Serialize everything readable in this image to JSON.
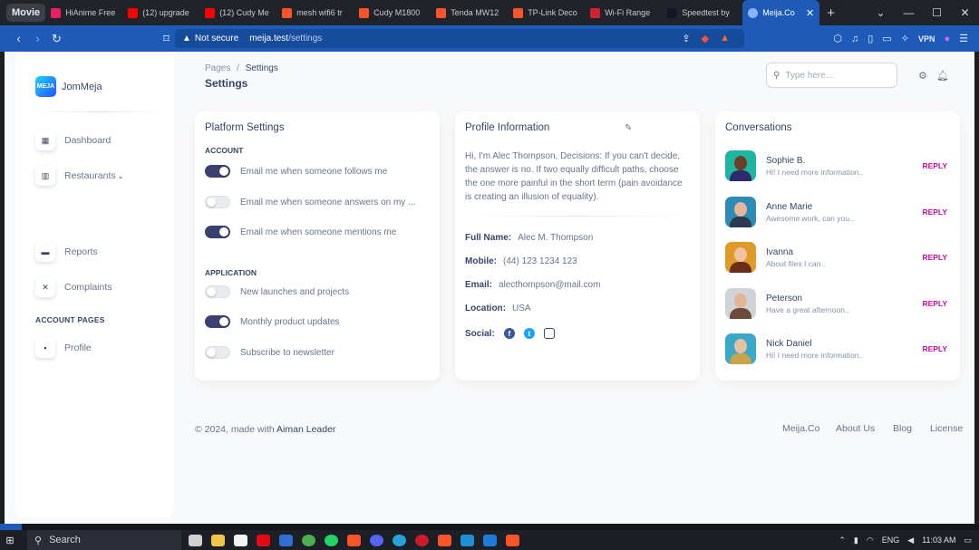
{
  "browser": {
    "tab_group_label": "Movie",
    "tabs": [
      {
        "title": "HiAnime Free",
        "icon": "hianime-icon",
        "color": "#e91e63"
      },
      {
        "title": "(12) upgrade",
        "icon": "youtube-icon",
        "color": "#ff0000"
      },
      {
        "title": "(12) Cudy Me",
        "icon": "youtube-icon",
        "color": "#ff0000"
      },
      {
        "title": "mesh wifi6 tr",
        "icon": "brave-search-icon",
        "color": "#fb542b"
      },
      {
        "title": "Cudy M1800",
        "icon": "brave-search-icon",
        "color": "#fb542b"
      },
      {
        "title": "Tenda MW12",
        "icon": "brave-search-icon",
        "color": "#fb542b"
      },
      {
        "title": "TP-Link Deco",
        "icon": "brave-search-icon",
        "color": "#fb542b"
      },
      {
        "title": "Wi-Fi Range",
        "icon": "pcmag-icon",
        "color": "#d1202f"
      },
      {
        "title": "Speedtest by",
        "icon": "speedtest-icon",
        "color": "#141526"
      }
    ],
    "active_tab": {
      "title": "Meija.Co",
      "icon": "globe-icon"
    },
    "new_tab_glyph": "+",
    "url_security": "Not secure",
    "url_host": "meija.test",
    "url_path": "/settings",
    "vpn_label": "VPN"
  },
  "sidebar": {
    "brand": "JomMeja",
    "logo_text": "MEJA",
    "items": [
      {
        "label": "Dashboard",
        "icon": "shop-icon"
      },
      {
        "label": "Restaurants",
        "icon": "office-icon"
      },
      {
        "label": "Reports",
        "icon": "credit-card-icon"
      },
      {
        "label": "Complaints",
        "icon": "tools-icon"
      }
    ],
    "section_title": "ACCOUNT PAGES",
    "account_items": [
      {
        "label": "Profile",
        "icon": "profile-icon"
      }
    ]
  },
  "header": {
    "breadcrumb_root": "Pages",
    "breadcrumb_sep": "/",
    "breadcrumb_current": "Settings",
    "title": "Settings",
    "search_placeholder": "Type here..."
  },
  "platform": {
    "title": "Platform Settings",
    "account_label": "ACCOUNT",
    "account_toggles": [
      {
        "label": "Email me when someone follows me",
        "on": true
      },
      {
        "label": "Email me when someone answers on my ...",
        "on": false
      },
      {
        "label": "Email me when someone mentions me",
        "on": true
      }
    ],
    "application_label": "APPLICATION",
    "application_toggles": [
      {
        "label": "New launches and projects",
        "on": false
      },
      {
        "label": "Monthly product updates",
        "on": true
      },
      {
        "label": "Subscribe to newsletter",
        "on": false
      }
    ]
  },
  "profile": {
    "title": "Profile Information",
    "bio": "Hi, I'm Alec Thompson, Decisions: If you can't decide, the answer is no. If two equally difficult paths, choose the one more painful in the short term (pain avoidance is creating an illusion of equality).",
    "fields": {
      "full_name_label": "Full Name:",
      "full_name": "Alec M. Thompson",
      "mobile_label": "Mobile:",
      "mobile": "(44) 123 1234 123",
      "email_label": "Email:",
      "email": "alecthompson@mail.com",
      "location_label": "Location:",
      "location": "USA",
      "social_label": "Social:"
    }
  },
  "conversations": {
    "title": "Conversations",
    "items": [
      {
        "name": "Sophie B.",
        "message": "Hi! I need more information..",
        "action": "REPLY",
        "bg": "#1fb5a3",
        "skin": "#6b3e26",
        "shirt": "#2d2a6e"
      },
      {
        "name": "Anne Marie",
        "message": "Awesome work, can you..",
        "action": "REPLY",
        "bg": "#2e8bb8",
        "skin": "#e6b59a",
        "shirt": "#2b3a4d"
      },
      {
        "name": "Ivanna",
        "message": "About files I can..",
        "action": "REPLY",
        "bg": "#e09a2a",
        "skin": "#f0c3a2",
        "shirt": "#6b2b1b"
      },
      {
        "name": "Peterson",
        "message": "Have a great afternoon..",
        "action": "REPLY",
        "bg": "#cfd4d8",
        "skin": "#e3b497",
        "shirt": "#6b4a3a"
      },
      {
        "name": "Nick Daniel",
        "message": "Hi! I need more information..",
        "action": "REPLY",
        "bg": "#3aa9c8",
        "skin": "#e7c29f",
        "shirt": "#c7a44a"
      }
    ]
  },
  "footer": {
    "copyright": "© 2024, made with",
    "author": "Aiman Leader",
    "links": [
      "Meija.Co",
      "About Us",
      "Blog",
      "License"
    ]
  },
  "taskbar": {
    "search_label": "Search",
    "lang": "ENG",
    "time": "11:03 AM"
  },
  "colors": {
    "accent": "#cb0c9f",
    "switch_on": "#3a416f",
    "browser_blue": "#1e5bb8"
  }
}
